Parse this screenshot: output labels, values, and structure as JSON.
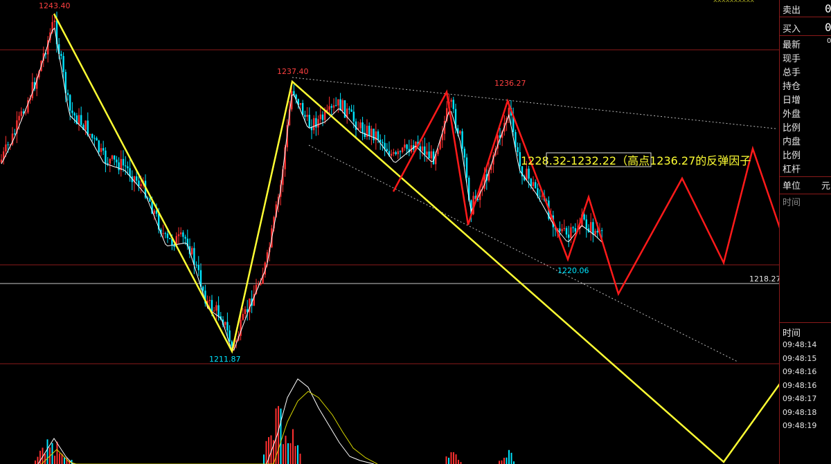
{
  "chart_data": {
    "type": "candlestick",
    "price_levels": {
      "high": "1243.40",
      "swing_low": "1211.87",
      "peak_2": "1237.40",
      "peak_3": "1236.27",
      "low_3": "1220.06",
      "current": "1218.27"
    },
    "annotation": "1228.32-1232.22（高点1236.27的反弹因子",
    "top_overlay_text": "xxxxxxxxxx",
    "colors": {
      "up": "#ff3030",
      "down": "#00e5ff",
      "yellow_line": "#ffff33",
      "red_line": "#ff1a1a",
      "grid": "#8b1a1a"
    }
  },
  "side_panel": {
    "labels": [
      "卖出",
      "买入",
      "最新",
      "现手",
      "总手",
      "持仓",
      "日增",
      "外盘",
      "比例",
      "内盘",
      "比例",
      "杠杆"
    ],
    "sell_value": "0",
    "buy_value": "0",
    "latest_value": "0",
    "unit_label": "单位",
    "unit_value": "元",
    "time_label_top": "时间",
    "time_label_bottom": "时间",
    "times": [
      "09:48:14",
      "09:48:15",
      "09:48:16",
      "09:48:16",
      "09:48:17",
      "09:48:18",
      "09:48:19"
    ]
  }
}
